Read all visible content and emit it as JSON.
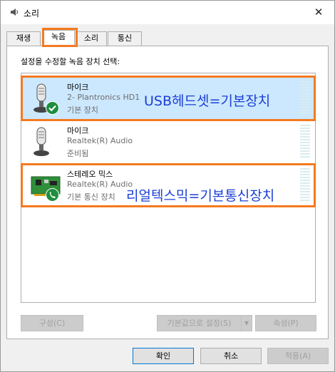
{
  "window": {
    "title": "소리",
    "close_glyph": "✕"
  },
  "tabs": [
    {
      "label": "재생"
    },
    {
      "label": "녹음"
    },
    {
      "label": "소리"
    },
    {
      "label": "통신"
    }
  ],
  "active_tab": "녹음",
  "panel": {
    "instruction": "설정을 수정할 녹음 장치 선택:"
  },
  "devices": [
    {
      "name": "마이크",
      "description": "2- Plantronics HD1",
      "status": "기본 장치",
      "icon": "headset-mic-icon",
      "badge": "check-badge-icon",
      "selected": true,
      "annotation": "USB헤드셋=기본장치"
    },
    {
      "name": "마이크",
      "description": "Realtek(R) Audio",
      "status": "준비됨",
      "icon": "microphone-icon",
      "selected": false
    },
    {
      "name": "스테레오 믹스",
      "description": "Realtek(R) Audio",
      "status": "기본 통신 장치",
      "icon": "sound-card-icon",
      "badge": "phone-badge-icon",
      "selected": false,
      "annotation": "리얼텍스믹=기본통신장치"
    }
  ],
  "panel_buttons": {
    "configure": "구성(C)",
    "set_default": "기본값으로 설정(S)",
    "properties": "속성(P)"
  },
  "dialog_buttons": {
    "ok": "확인",
    "cancel": "취소",
    "apply": "적용(A)"
  },
  "colors": {
    "highlight_box": "#f47a20",
    "annotation_text": "#1a3fd6",
    "selection": "#cce8ff",
    "badge_green": "#1e8e3e"
  }
}
